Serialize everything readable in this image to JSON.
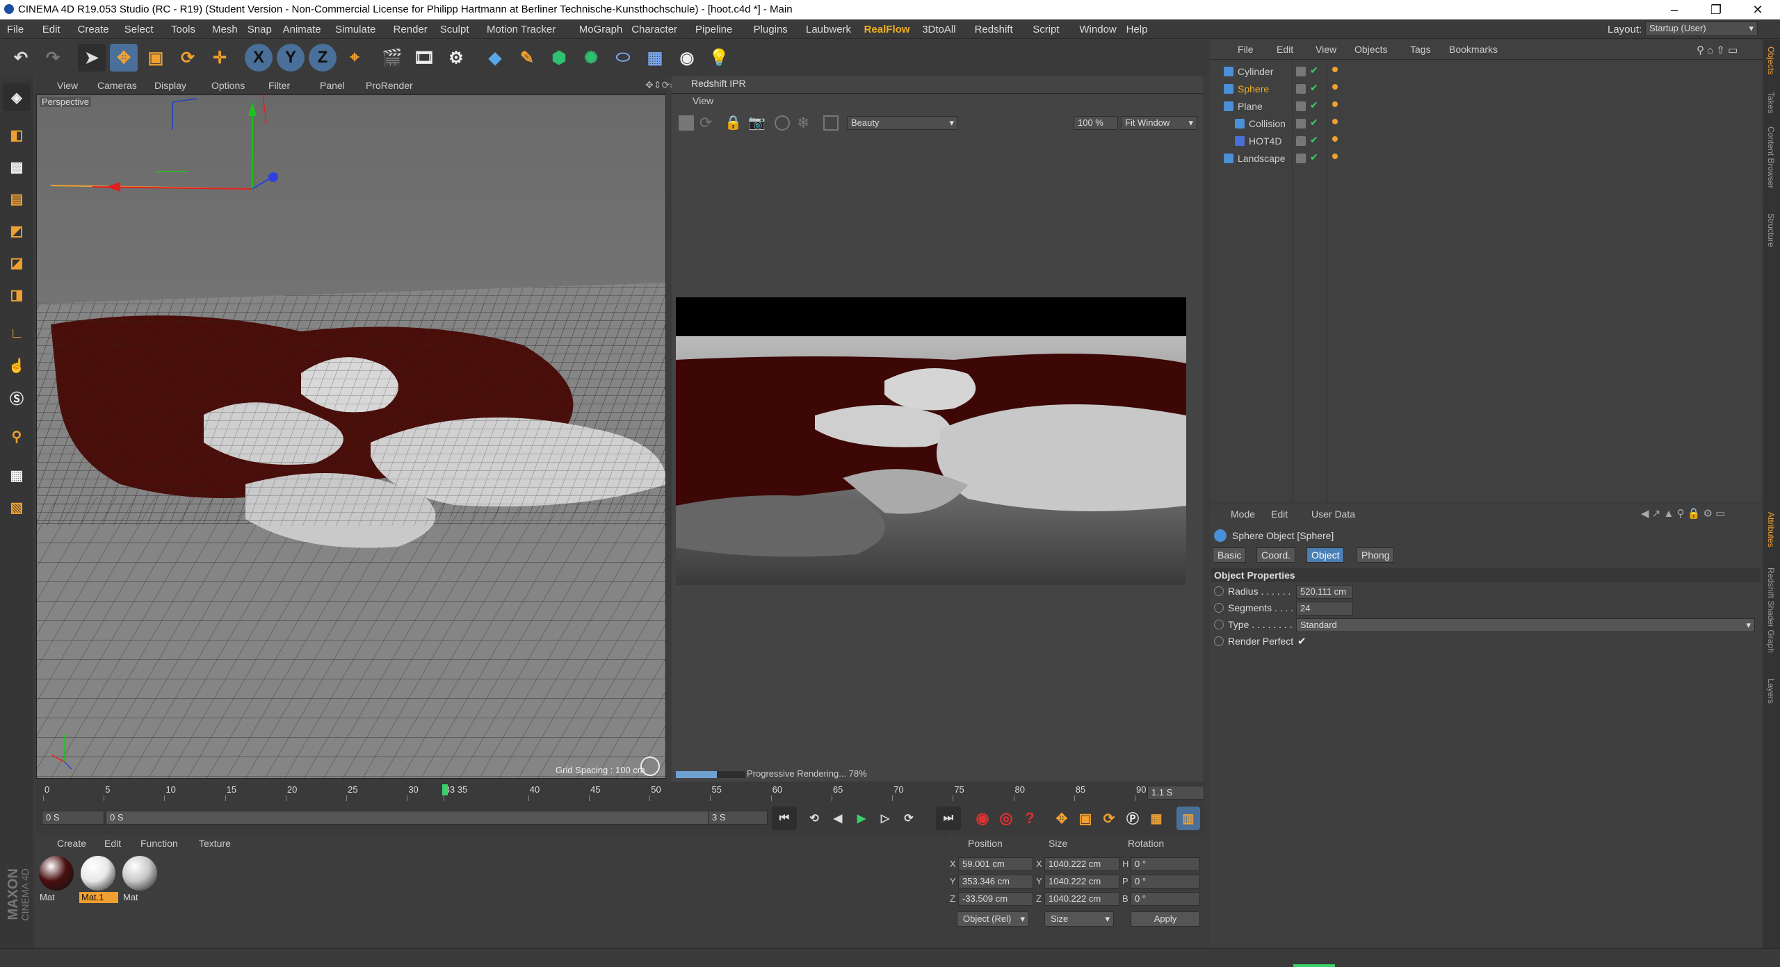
{
  "window": {
    "title": "CINEMA 4D R19.053 Studio (RC - R19) (Student Version - Non-Commercial License for Philipp Hartmann at Berliner Technische-Kunsthochschule) - [hoot.c4d *] - Main",
    "min": "–",
    "max": "❐",
    "close": "✕"
  },
  "menu": {
    "items": [
      "File",
      "Edit",
      "Create",
      "Select",
      "Tools",
      "Mesh",
      "Snap",
      "Animate",
      "Simulate",
      "Render",
      "Sculpt",
      "Motion Tracker",
      "MoGraph",
      "Character",
      "Pipeline",
      "Plugins",
      "Laubwerk",
      "RealFlow",
      "3DtoAll",
      "Redshift",
      "Script",
      "Window",
      "Help"
    ],
    "highlight": "RealFlow",
    "layout_label": "Layout:",
    "layout_value": "Startup (User)"
  },
  "toolbar": {
    "icons": [
      "undo-icon",
      "redo-icon",
      "select-arrow-icon",
      "move-icon",
      "scale-icon",
      "rotate-icon",
      "live-select-icon",
      "x-axis-lock-icon",
      "y-axis-lock-icon",
      "z-axis-lock-icon",
      "world-coord-icon",
      "render-view-icon",
      "render-picture-viewer-icon",
      "render-settings-icon",
      "cube-icon",
      "pen-icon",
      "subdivision-icon",
      "array-icon",
      "deformer-icon",
      "floor-icon",
      "camera-icon",
      "light-icon"
    ],
    "axis": [
      "X",
      "Y",
      "Z"
    ]
  },
  "viewport": {
    "menu": [
      "View",
      "Cameras",
      "Display",
      "Options",
      "Filter",
      "Panel",
      "ProRender"
    ],
    "label": "Perspective",
    "grid_spacing": "Grid Spacing : 100 cm"
  },
  "ipr": {
    "title": "Redshift IPR",
    "view_menu": "View",
    "aov": "Beauty",
    "zoom": "100 %",
    "fit": "Fit Window",
    "progress_text": "Progressive Rendering... 78%",
    "progress": 0.78
  },
  "timeline": {
    "ticks": [
      "0",
      "5",
      "10",
      "15",
      "20",
      "25",
      "30",
      "33 35",
      "40",
      "45",
      "50",
      "55",
      "60",
      "65",
      "70",
      "75",
      "80",
      "85",
      "90"
    ],
    "current": "1.1 S",
    "start": "0 S",
    "min": "0 S",
    "max": "3 S",
    "end": "3 S",
    "playhead_frame": 33,
    "playhead_label": "33",
    "frame_max": 90
  },
  "materials": {
    "menu": [
      "Create",
      "Edit",
      "Function",
      "Texture"
    ],
    "items": [
      {
        "name": "Mat",
        "color": "#4a1010",
        "selected": false
      },
      {
        "name": "Mat.1",
        "color": "#e8e8e8",
        "selected": true
      },
      {
        "name": "Mat",
        "color": "#c8c8c8",
        "selected": false
      }
    ],
    "brand1": "MAXON",
    "brand2": "CINEMA 4D"
  },
  "coords": {
    "headers": [
      "Position",
      "Size",
      "Rotation"
    ],
    "rows": [
      {
        "axis": "X",
        "pos": "59.001 cm",
        "saxis": "X",
        "size": "1040.222 cm",
        "raxis": "H",
        "rot": "0 °"
      },
      {
        "axis": "Y",
        "pos": "353.346 cm",
        "saxis": "Y",
        "size": "1040.222 cm",
        "raxis": "P",
        "rot": "0 °"
      },
      {
        "axis": "Z",
        "pos": "-33.509 cm",
        "saxis": "Z",
        "size": "1040.222 cm",
        "raxis": "B",
        "rot": "0 °"
      }
    ],
    "mode": "Object (Rel)",
    "sizemode": "Size",
    "apply": "Apply"
  },
  "objects": {
    "menu": [
      "File",
      "Edit",
      "View",
      "Objects",
      "Tags",
      "Bookmarks"
    ],
    "rows": [
      {
        "name": "Cylinder",
        "indent": 0,
        "selected": false,
        "color": "#ccc"
      },
      {
        "name": "Sphere",
        "indent": 0,
        "selected": true,
        "color": "#f0b020"
      },
      {
        "name": "Plane",
        "indent": 0,
        "selected": false,
        "color": "#ccc"
      },
      {
        "name": "Collision",
        "indent": 1,
        "selected": false,
        "color": "#ccc"
      },
      {
        "name": "HOT4D",
        "indent": 1,
        "selected": false,
        "color": "#ccc"
      },
      {
        "name": "Landscape",
        "indent": 0,
        "selected": false,
        "color": "#ccc"
      }
    ]
  },
  "attributes": {
    "menu": [
      "Mode",
      "Edit",
      "User Data"
    ],
    "object_title": "Sphere Object [Sphere]",
    "tabs": [
      "Basic",
      "Coord.",
      "Object",
      "Phong"
    ],
    "active_tab": "Object",
    "section": "Object Properties",
    "props": [
      {
        "label": "Radius . . . . . .",
        "value": "520.111 cm"
      },
      {
        "label": "Segments . . . .",
        "value": "24"
      },
      {
        "label": "Type . . . . . . . .",
        "value": "Standard"
      },
      {
        "label": "Render Perfect",
        "value": "✔"
      }
    ]
  },
  "side_tabs": {
    "top": [
      "Objects",
      "Takes",
      "Content Browser",
      "Structure"
    ],
    "bottom": [
      "Attributes",
      "Redshift Shader Graph",
      "Layers"
    ]
  }
}
